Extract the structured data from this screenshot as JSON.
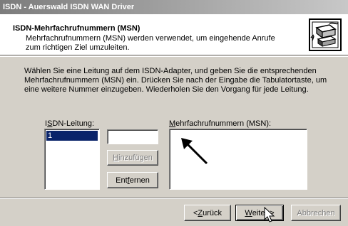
{
  "window": {
    "title": "ISDN - Auerswald ISDN WAN Driver"
  },
  "header": {
    "title": "ISDN-Mehrfachrufnummern (MSN)",
    "subtitle": "Mehrfachrufnummern (MSN) werden verwendet, um eingehende Anrufe zum richtigen Ziel umzuleiten.",
    "icon": "isdn-network-icon"
  },
  "body": {
    "instruction": "Wählen Sie eine Leitung auf dem ISDN-Adapter, und geben Sie die entsprechenden Mehrfachrufnummern (MSN) ein. Drücken Sie nach der Eingabe die Tabulatortaste, um eine weitere Nummer einzugeben. Wiederholen Sie den Vorgang für jede Leitung."
  },
  "isdn_lines": {
    "label_pre": "I",
    "label_accel": "S",
    "label_post": "DN-Leitung:",
    "items": [
      "1"
    ],
    "selected": "1"
  },
  "msn": {
    "input_value": "",
    "add_pre": "",
    "add_accel": "H",
    "add_post": "inzufügen",
    "remove_pre": "Ent",
    "remove_accel": "f",
    "remove_post": "ernen",
    "list_label_pre": "",
    "list_label_accel": "M",
    "list_label_post": "ehrfachrufnummern (MSN):",
    "items": []
  },
  "footer": {
    "back_pre": "< ",
    "back_accel": "Z",
    "back_post": "urück",
    "next_pre": "",
    "next_accel": "W",
    "next_post": "eiter >",
    "cancel": "Abbrechen"
  },
  "annotation": {
    "arrow": "pointer-arrow"
  }
}
